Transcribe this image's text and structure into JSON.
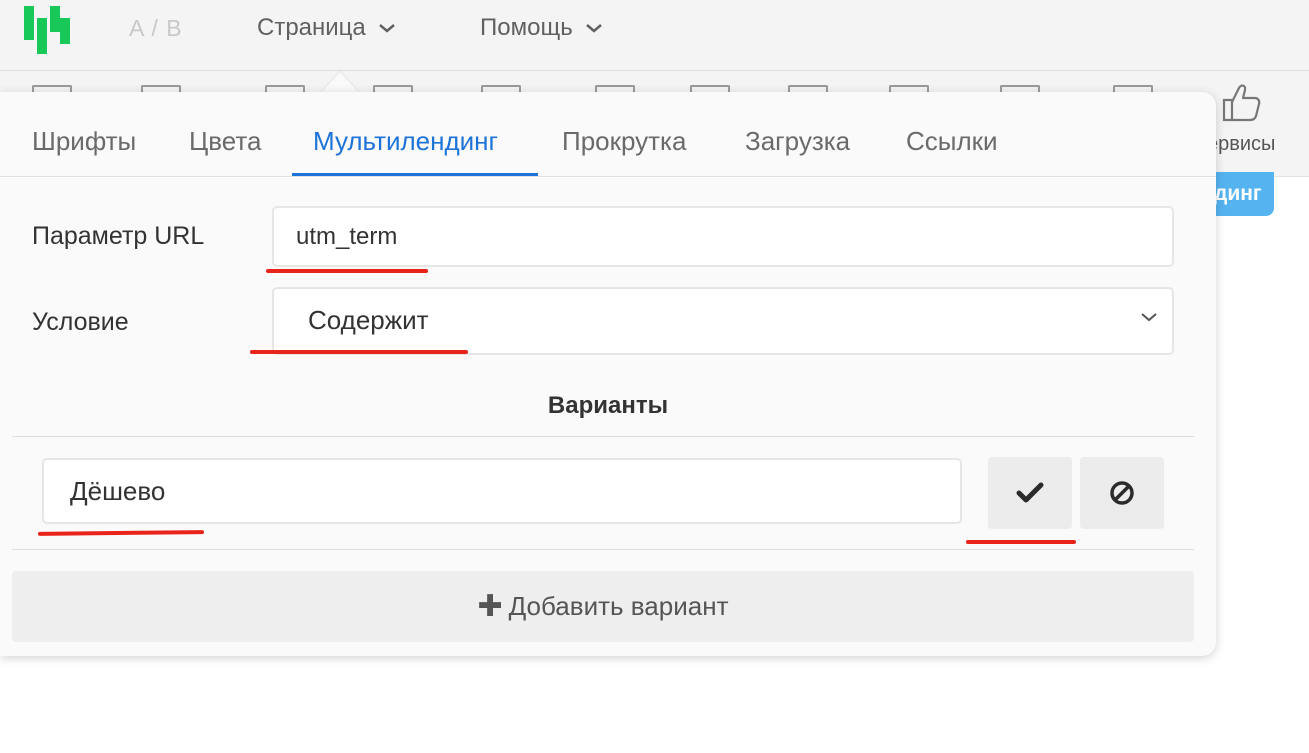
{
  "header": {
    "ab_label": "A / B",
    "menus": [
      {
        "label": "Страница"
      },
      {
        "label": "Помощь"
      }
    ]
  },
  "toolbar": {
    "services_label": "ервисы",
    "active_item_label": "динг"
  },
  "panel": {
    "tabs": [
      {
        "label": "Шрифты",
        "active": false
      },
      {
        "label": "Цвета",
        "active": false
      },
      {
        "label": "Мультилендинг",
        "active": true
      },
      {
        "label": "Прокрутка",
        "active": false
      },
      {
        "label": "Загрузка",
        "active": false
      },
      {
        "label": "Ссылки",
        "active": false
      }
    ],
    "url_param": {
      "label": "Параметр URL",
      "value": "utm_term"
    },
    "condition": {
      "label": "Условие",
      "value": "Содержит"
    },
    "variants_title": "Варианты",
    "variant_input": {
      "value": "Дёшево"
    },
    "add_variant_label": "Добавить вариант"
  },
  "colors": {
    "accent": "#1c73d8",
    "logo_green": "#18c95a",
    "annotation_red": "#e8231a",
    "pill_blue": "#55b3f0"
  }
}
